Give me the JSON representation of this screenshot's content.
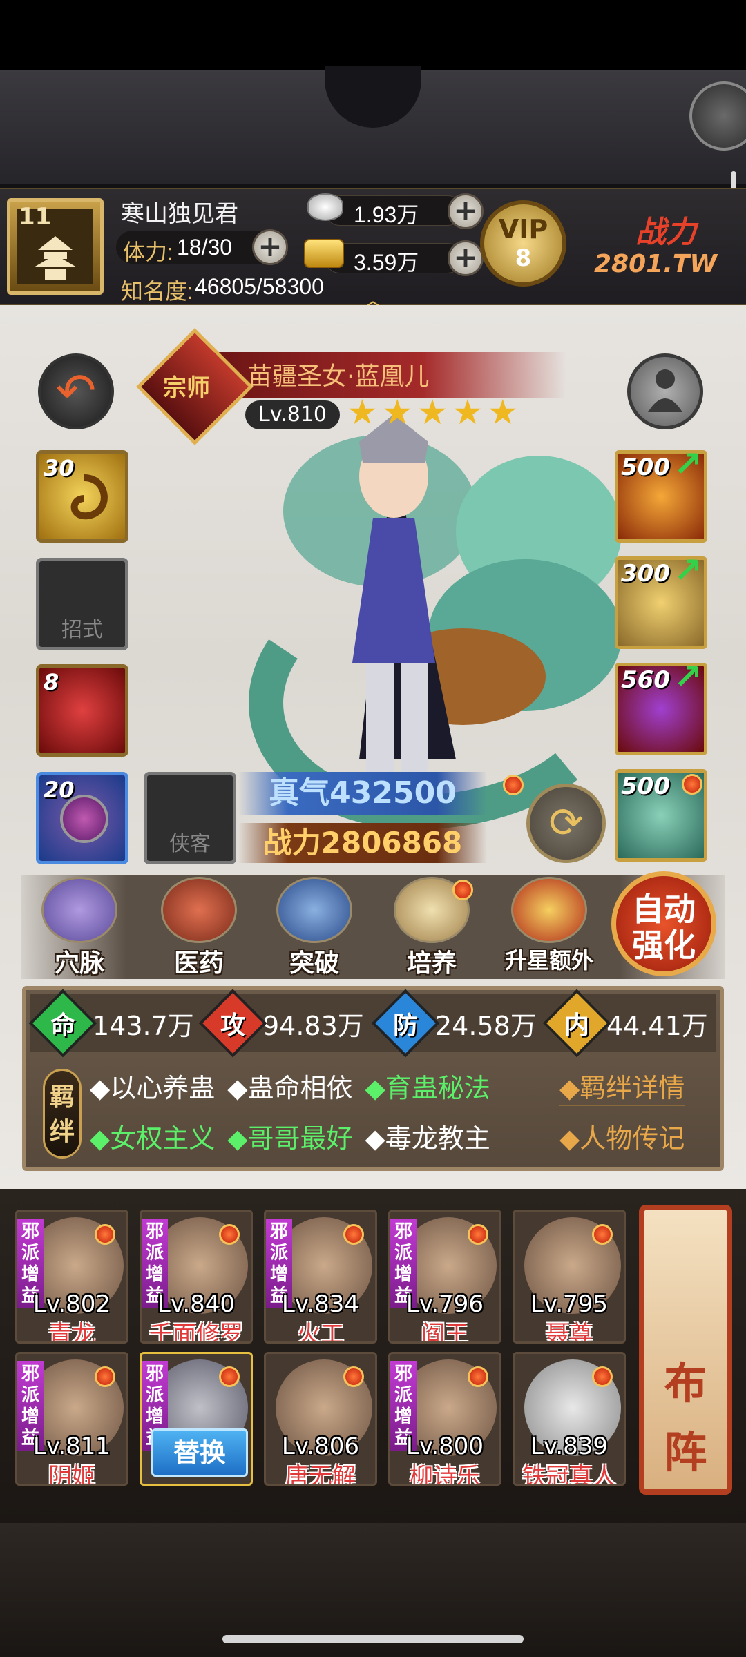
{
  "player": {
    "level": "11",
    "name": "寒山独见君",
    "stamina_label": "体力:",
    "stamina": "18/30",
    "fame_label": "知名度:",
    "fame": "46805/58300",
    "silver": "1.93万",
    "gold": "3.59万",
    "vip_label": "VIP",
    "vip_level": "8",
    "power_label": "战力",
    "power_value": "2801.TW"
  },
  "hero": {
    "rank_badge": "宗师",
    "name": "苗疆圣女·蓝凰儿",
    "level": "Lv.810",
    "stars": 5,
    "zhenqi_label": "真气",
    "zhenqi": "432500",
    "power_label": "战力",
    "power": "2806868"
  },
  "skills": [
    {
      "num": "30",
      "label": ""
    },
    {
      "num": "",
      "label": "招式"
    },
    {
      "num": "8",
      "label": ""
    },
    {
      "num": "20",
      "label": ""
    },
    {
      "num": "",
      "label": "侠客"
    }
  ],
  "equipment": [
    {
      "num": "500"
    },
    {
      "num": "300"
    },
    {
      "num": "560"
    },
    {
      "num": "500"
    }
  ],
  "functions": [
    {
      "label": "穴脉"
    },
    {
      "label": "医药"
    },
    {
      "label": "突破"
    },
    {
      "label": "培养"
    },
    {
      "label": "升星额外"
    }
  ],
  "auto_button": {
    "line1": "自动",
    "line2": "强化"
  },
  "stats": [
    {
      "icon": "命",
      "value": "143.7万",
      "color": "#2fb84a"
    },
    {
      "icon": "攻",
      "value": "94.83万",
      "color": "#d83a2a"
    },
    {
      "icon": "防",
      "value": "24.58万",
      "color": "#2a86d8"
    },
    {
      "icon": "内",
      "value": "44.41万",
      "color": "#e0a72a"
    }
  ],
  "bond_label": "羁绊",
  "bonds_row1": [
    {
      "text": "◆以心养蛊",
      "active": false
    },
    {
      "text": "◆蛊命相依",
      "active": false
    },
    {
      "text": "◆育蛊秘法",
      "active": true
    }
  ],
  "bonds_row2": [
    {
      "text": "◆女权主义",
      "active": true
    },
    {
      "text": "◆哥哥最好",
      "active": true
    },
    {
      "text": "◆毒龙教主",
      "active": false
    }
  ],
  "bond_links": {
    "details": "◆羁绊详情",
    "biography": "◆人物传记"
  },
  "team_row1": [
    {
      "level": "Lv.802",
      "name": "青龙",
      "faction": "邪派增益"
    },
    {
      "level": "Lv.840",
      "name": "千面修罗",
      "faction": "邪派增益"
    },
    {
      "level": "Lv.834",
      "name": "火工",
      "faction": "邪派增益"
    },
    {
      "level": "Lv.796",
      "name": "阎王",
      "faction": "邪派增益"
    },
    {
      "level": "Lv.795",
      "name": "聂尊",
      "faction": ""
    }
  ],
  "team_row2": [
    {
      "level": "Lv.811",
      "name": "阴姬",
      "faction": "邪派增益"
    },
    {
      "level": "",
      "name": "",
      "faction": "邪派增益",
      "swap": "替换"
    },
    {
      "level": "Lv.806",
      "name": "唐无解",
      "faction": ""
    },
    {
      "level": "Lv.800",
      "name": "柳诗乐",
      "faction": "邪派增益"
    },
    {
      "level": "Lv.839",
      "name": "铁冠真人",
      "faction": ""
    }
  ],
  "formation_button": {
    "line1": "布",
    "line2": "阵"
  }
}
